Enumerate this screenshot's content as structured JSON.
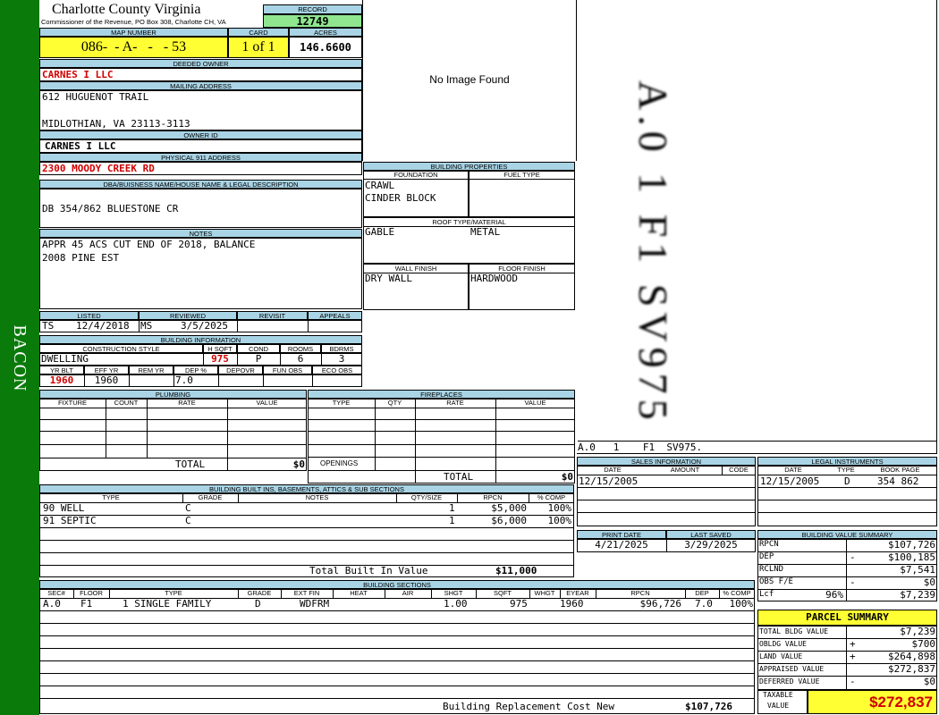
{
  "side_label": "BACON",
  "header": {
    "county": "Charlotte County Virginia",
    "commissioner": "Commissioner of the Revenue, PO Box 308, Charlotte CH, VA",
    "record_label": "RECORD",
    "record": "12749",
    "map_label": "MAP NUMBER",
    "map_number": "086-  - A-   -   - 53",
    "card_label": "CARD",
    "card": "1 of 1",
    "acres_label": "ACRES",
    "acres": "146.6600"
  },
  "owner": {
    "deeded_label": "DEEDED OWNER",
    "deeded_owner": "CARNES I LLC",
    "mailing_label": "MAILING ADDRESS",
    "mailing_line1": "612 HUGUENOT TRAIL",
    "mailing_line2": "MIDLOTHIAN, VA 23113-3113",
    "owner_id_label": "OWNER ID",
    "owner_id": "CARNES I LLC",
    "physical_label": "PHYSICAL 911 ADDRESS",
    "physical_address": "2300 MOODY CREEK RD",
    "dba_label": "DBA/BUISNESS NAME/HOUSE NAME & LEGAL DESCRIPTION",
    "dba": "DB 354/862 BLUESTONE CR",
    "notes_label": "NOTES",
    "notes_line1": "APPR 45 ACS CUT END OF 2018, BALANCE",
    "notes_line2": "2008 PINE EST"
  },
  "image": {
    "no_image": "No Image Found"
  },
  "building_properties": {
    "title": "BUILDING PROPERTIES",
    "foundation_label": "FOUNDATION",
    "fuel_label": "FUEL TYPE",
    "foundation1": "CRAWL",
    "foundation2": "CINDER BLOCK",
    "roof_label": "ROOF TYPE/MATERIAL",
    "roof_type": "GABLE",
    "roof_material": "METAL",
    "wall_label": "WALL FINISH",
    "floor_label": "FLOOR FINISH",
    "wall": "DRY WALL",
    "floor": "HARDWOOD"
  },
  "sketch": {
    "caption": "A.0   1    F1  SV975.",
    "vertical_text": "A.0 1 F1 SV975"
  },
  "listing": {
    "listed_label": "LISTED",
    "reviewed_label": "REVIEWED",
    "revisit_label": "REVISIT",
    "appeals_label": "APPEALS",
    "listed_by": "TS",
    "listed_date": "12/4/2018",
    "reviewed_by": "MS",
    "reviewed_date": "3/5/2025"
  },
  "building_info": {
    "title": "BUILDING INFORMATION",
    "style_label": "CONSTRUCTION STYLE",
    "hsqft_label": "H SQFT",
    "cond_label": "COND",
    "rooms_label": "ROOMS",
    "bdrms_label": "BDRMS",
    "style": "DWELLING",
    "hsqft": "975",
    "cond": "P",
    "rooms": "6",
    "bdrms": "3",
    "yrblt_label": "YR BLT",
    "effyr_label": "EFF YR",
    "remyr_label": "REM YR",
    "dep_label": "DEP %",
    "depovr_label": "DEPOVR",
    "funobs_label": "FUN OBS",
    "ecoobs_label": "ECO OBS",
    "yrblt": "1960",
    "effyr": "1960",
    "dep": "7.0"
  },
  "plumbing": {
    "title": "PLUMBING",
    "fixture_label": "FIXTURE",
    "count_label": "COUNT",
    "rate_label": "RATE",
    "value_label": "VALUE",
    "total_label": "TOTAL",
    "total": "$0"
  },
  "fireplaces": {
    "title": "FIREPLACES",
    "type_label": "TYPE",
    "qty_label": "QTY",
    "rate_label": "RATE",
    "value_label": "VALUE",
    "openings_label": "OPENINGS",
    "total_label": "TOTAL",
    "total": "$0"
  },
  "sales": {
    "title": "SALES INFORMATION",
    "date_label": "DATE",
    "amount_label": "AMOUNT",
    "code_label": "CODE",
    "date": "12/15/2005"
  },
  "legal": {
    "title": "LEGAL INSTRUMENTS",
    "date_label": "DATE",
    "type_label": "TYPE",
    "bookpage_label": "BOOK PAGE",
    "date": "12/15/2005",
    "type": "D",
    "bookpage": "354 862"
  },
  "builtins": {
    "title": "BUILDING BUILT INS, BASEMENTS, ATTICS & SUB SECTIONS",
    "type_label": "TYPE",
    "grade_label": "GRADE",
    "notes_label": "NOTES",
    "qty_label": "QTY/SIZE",
    "rpcn_label": "RPCN",
    "comp_label": "% COMP",
    "rows": [
      {
        "type": "90 WELL",
        "grade": "C",
        "qty": "1",
        "rpcn": "$5,000",
        "comp": "100%"
      },
      {
        "type": "91 SEPTIC",
        "grade": "C",
        "qty": "1",
        "rpcn": "$6,000",
        "comp": "100%"
      }
    ],
    "total_label": "Total Built In Value",
    "total": "$11,000"
  },
  "dates": {
    "print_label": "PRINT DATE",
    "saved_label": "LAST SAVED",
    "print_date": "4/21/2025",
    "last_saved": "3/29/2025"
  },
  "value_summary": {
    "title": "BUILDING VALUE SUMMARY",
    "rows": [
      {
        "label": "RPCN",
        "sign": "",
        "value": "$107,726"
      },
      {
        "label": "DEP",
        "sign": "-",
        "value": "$100,185"
      },
      {
        "label": "RCLND",
        "sign": "",
        "value": "$7,541"
      },
      {
        "label": "OBS F/E",
        "sign": "-",
        "value": "$0"
      },
      {
        "label": "Lcf",
        "pct": "96%",
        "sign": "",
        "value": "$7,239"
      }
    ]
  },
  "sections": {
    "title": "BUILDING SECTIONS",
    "sec_label": "SEC#",
    "floor_label": "FLOOR",
    "type_label": "TYPE",
    "grade_label": "GRADE",
    "extfin_label": "EXT FIN",
    "heat_label": "HEAT",
    "air_label": "AIR",
    "shgt_label": "SHGT",
    "sqft_label": "SQFT",
    "whgt_label": "WHGT",
    "eyear_label": "EYEAR",
    "rpcn_label": "RPCN",
    "dep_label": "DEP",
    "comp_label": "% COMP",
    "row": {
      "sec": "A.0",
      "floor": "F1",
      "type": "1 SINGLE FAMILY",
      "grade": "D",
      "extfin": "WDFRM",
      "shgt": "1.00",
      "sqft": "975",
      "eyear": "1960",
      "rpcn": "$96,726",
      "dep": "7.0",
      "comp": "100%"
    },
    "brcn_label": "Building Replacement Cost New",
    "brcn": "$107,726"
  },
  "parcel_summary": {
    "title": "PARCEL SUMMARY",
    "rows": [
      {
        "label": "TOTAL BLDG VALUE",
        "sign": "",
        "value": "$7,239"
      },
      {
        "label": "OBLDG VALUE",
        "sign": "+",
        "value": "$700"
      },
      {
        "label": "LAND VALUE",
        "sign": "+",
        "value": "$264,898"
      },
      {
        "label": "APPRAISED VALUE",
        "sign": "",
        "value": "$272,837"
      },
      {
        "label": "DEFERRED VALUE",
        "sign": "-",
        "value": "$0"
      }
    ],
    "taxable_label1": "TAXABLE",
    "taxable_label2": "VALUE",
    "taxable": "$272,837"
  }
}
